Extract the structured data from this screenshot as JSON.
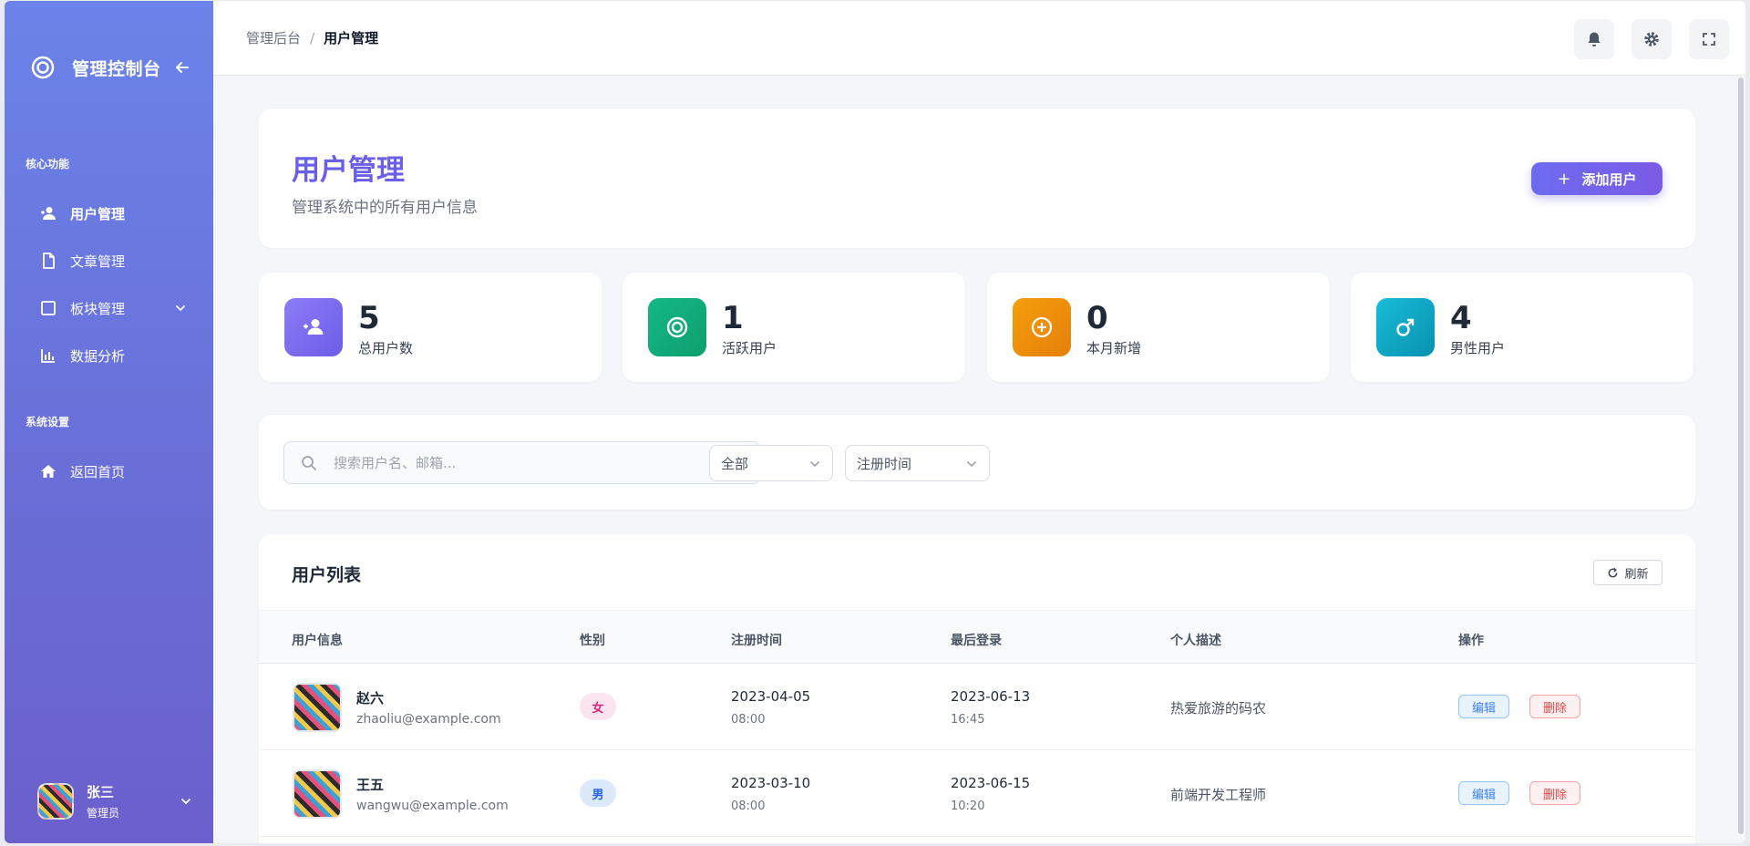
{
  "sidebar": {
    "brand_title": "管理控制台",
    "sections": [
      {
        "title": "核心功能",
        "items": [
          {
            "label": "用户管理",
            "icon": "user-icon"
          },
          {
            "label": "文章管理",
            "icon": "document-icon"
          },
          {
            "label": "板块管理",
            "icon": "square-icon"
          },
          {
            "label": "数据分析",
            "icon": "chart-icon"
          }
        ]
      },
      {
        "title": "系统设置",
        "items": [
          {
            "label": "返回首页",
            "icon": "home-icon"
          }
        ]
      }
    ],
    "user": {
      "name": "张三",
      "role": "管理员"
    }
  },
  "topbar": {
    "breadcrumb": [
      "管理后台",
      "用户管理"
    ],
    "separator": "/"
  },
  "header": {
    "title": "用户管理",
    "subtitle": "管理系统中的所有用户信息",
    "add_button": "添加用户"
  },
  "stats": [
    {
      "value": "5",
      "label": "总用户数",
      "icon": "user-icon",
      "color": "#7c6cf0"
    },
    {
      "value": "1",
      "label": "活跃用户",
      "icon": "target-icon",
      "color": "#10b981"
    },
    {
      "value": "0",
      "label": "本月新增",
      "icon": "plus-circle-icon",
      "color": "#f59e0b"
    },
    {
      "value": "4",
      "label": "男性用户",
      "icon": "male-icon",
      "color": "#06b6d4"
    }
  ],
  "filters": {
    "search_placeholder": "搜索用户名、邮箱...",
    "gender_select": "全部",
    "sort_select": "注册时间"
  },
  "table": {
    "title": "用户列表",
    "refresh": "刷新",
    "columns": [
      "用户信息",
      "性别",
      "注册时间",
      "最后登录",
      "个人描述",
      "操作"
    ],
    "rows": [
      {
        "name": "赵六",
        "email": "zhaoliu@example.com",
        "gender": "女",
        "reg_date": "2023-04-05",
        "reg_time": "08:00",
        "login_date": "2023-06-13",
        "login_time": "16:45",
        "desc": "热爱旅游的码农",
        "edit": "编辑",
        "delete": "删除"
      },
      {
        "name": "王五",
        "email": "wangwu@example.com",
        "gender": "男",
        "reg_date": "2023-03-10",
        "reg_time": "08:00",
        "login_date": "2023-06-15",
        "login_time": "10:20",
        "desc": "前端开发工程师",
        "edit": "编辑",
        "delete": "删除"
      }
    ]
  }
}
